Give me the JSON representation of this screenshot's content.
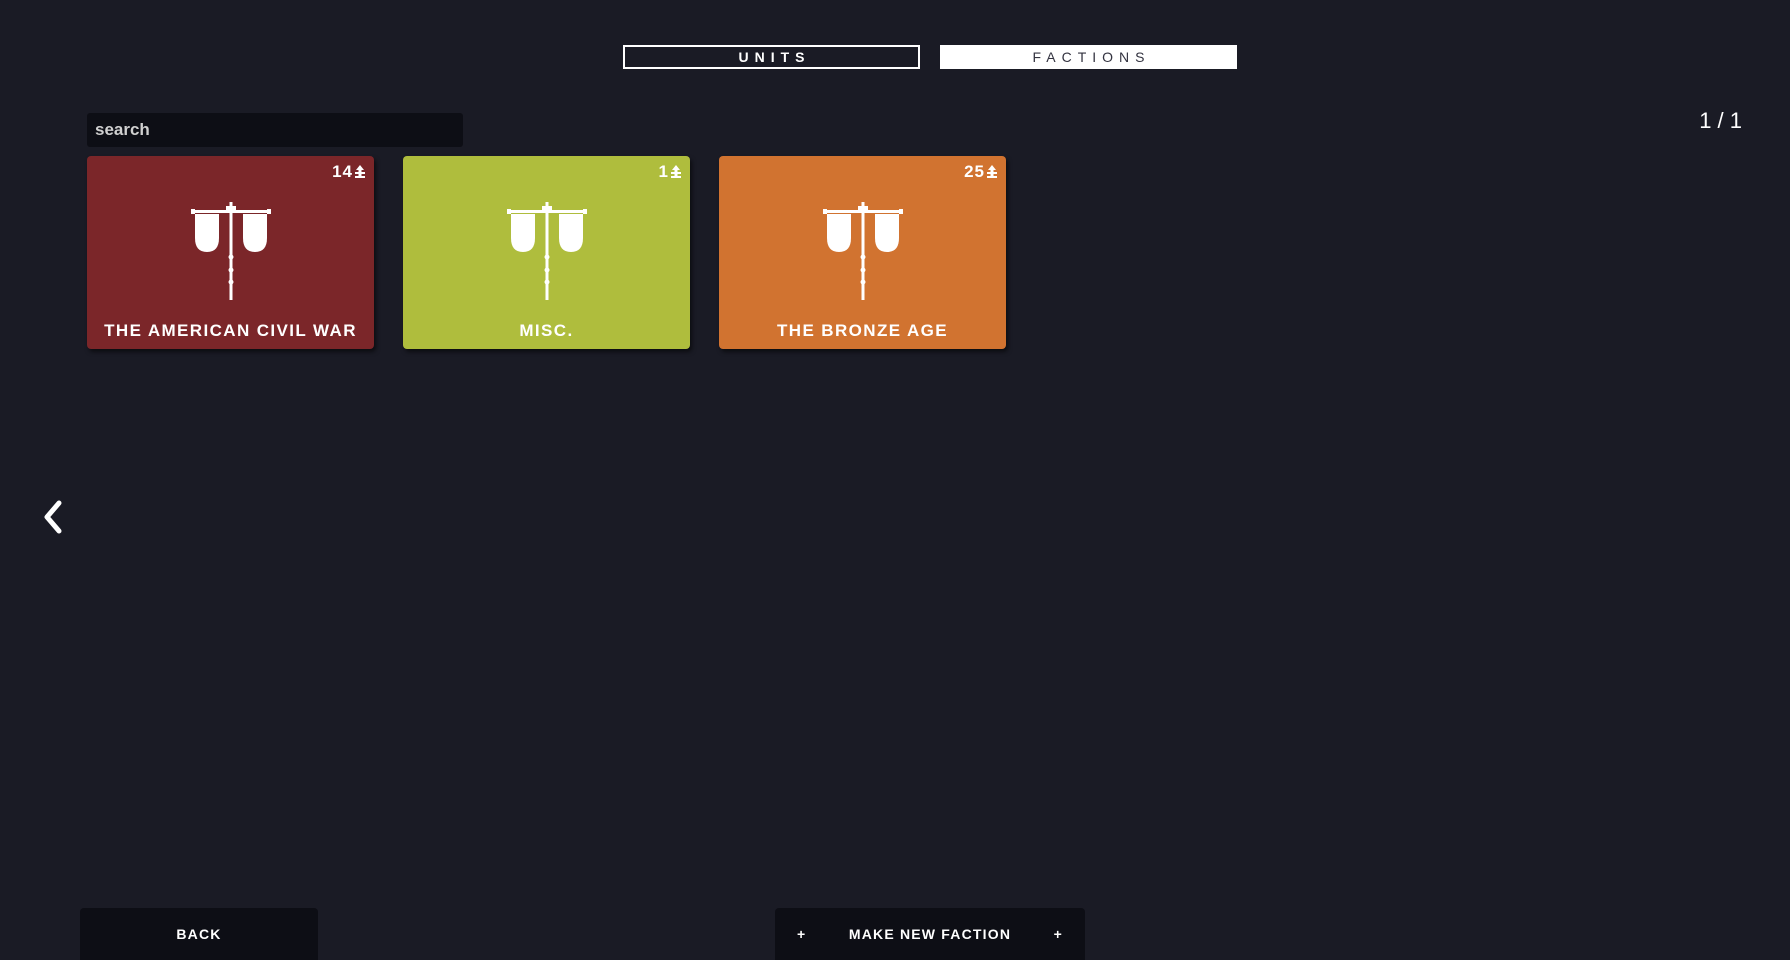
{
  "tabs": {
    "units_label": "UNITS",
    "factions_label": "FACTIONS"
  },
  "search": {
    "placeholder": "search",
    "value": ""
  },
  "pagination": {
    "indicator": "1 / 1"
  },
  "factions": [
    {
      "name": "THE AMERICAN CIVIL WAR",
      "count": "14",
      "color": "#7b2629"
    },
    {
      "name": "MISC.",
      "count": "1",
      "color": "#afbd3d"
    },
    {
      "name": "THE BRONZE AGE",
      "count": "25",
      "color": "#d17330"
    }
  ],
  "icons": {
    "count": "unit-icon",
    "emblem": "banner-emblem-icon",
    "nav": "chevron-left-icon"
  },
  "buttons": {
    "back_label": "BACK",
    "new_faction_label": "MAKE NEW FACTION",
    "plus": "+"
  }
}
